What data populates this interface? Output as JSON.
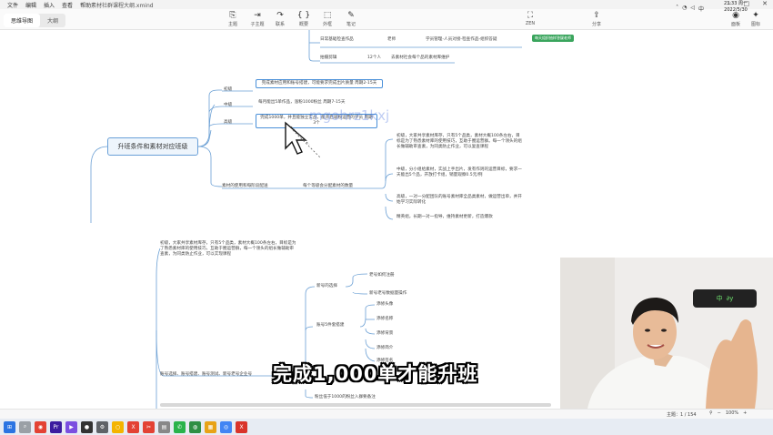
{
  "app": {
    "menus": [
      "文件",
      "编辑",
      "插入",
      "查看",
      "帮助"
    ],
    "window_title": "素材社群课程大纲.xmind"
  },
  "toolbar": {
    "view_tabs": [
      "思维导图",
      "大纲"
    ],
    "active_tab": "思维导图",
    "left_tools": [
      {
        "label": "主题",
        "icon": "topic-icon"
      },
      {
        "label": "子主题",
        "icon": "subtopic-icon"
      },
      {
        "label": "联系",
        "icon": "relationship-icon"
      },
      {
        "label": "概要",
        "icon": "summary-icon"
      },
      {
        "label": "外框",
        "icon": "boundary-icon"
      },
      {
        "label": "笔记",
        "icon": "note-icon"
      }
    ],
    "zen_label": "ZEN",
    "share_label": "分享",
    "right_tools": [
      {
        "label": "面板",
        "icon": "format-icon"
      },
      {
        "label": "图标",
        "icon": "icons-icon"
      }
    ]
  },
  "mindmap": {
    "root": "升班条件和素材对应班级",
    "top_rows": [
      {
        "left": "日常基础检查作品",
        "mid": "老师",
        "right": "学员管理-人员对接-检查作品-组织答疑"
      },
      {
        "left": "拍摄剪辑",
        "mid": "12个人",
        "right": "去素材社会每个品的素材库维护"
      }
    ],
    "badge": "每天组织抽样答疑老师",
    "levels": [
      {
        "label": "初级",
        "box": "完成素材应用和账号搭建，可能要求完成出片质量 周期2-15天"
      },
      {
        "label": "中级",
        "box": "每月能出5单作品，涨粉1000粉丝 周期7-15天"
      },
      {
        "label": "高级",
        "box": "完成1000单，并且能独立实战，能开启吸粉运营的学员 周期3个"
      }
    ],
    "material_branch": "素材的使用和每阶段配送",
    "material_sub": "每个等级会分配素材的数量",
    "material_items": [
      "初级，大家共享素材库存，只有5个品类，素材大概100条左右，目标是为了熟悉素材库的使用技巧，互助于圈运营群。每一个领头的组长做辅助审查素，为同类防止作业，可以复查课程",
      "中级，分小组给素材，实战上手出片，发有作则的运营目标，要求一天能出5个品，开放打卡组，销量观察0.5元/例",
      "高级，一对一分配团队的账号素材库全品类素材，做运营出单，并开始学习实际转化",
      "精英组，长期一对一指导，维持素材更新，打造爆款"
    ],
    "lower_intro": "初级，大家共享素材库存，只有5个品类，素材大概100条左右，目标是为了熟悉素材库的使用技巧，互助于圈运营群，每一个领头的组长做辅助审查素，为同类防止作业，可以实现课程",
    "account": {
      "branch": "账号选择、账号搭建、账号测试、新号老号企业号",
      "choose": "新号的选择",
      "choose_items": [
        "老号如何注册",
        "新号老号数据量操作"
      ],
      "build": "账号5件套搭建",
      "build_items": [
        "添修头像",
        "添修名称",
        "添修背景",
        "添修简介",
        "添修签名"
      ],
      "bottom": "粉丝低于1000的粉丝入群要备注"
    },
    "watermark": "mgohrz1kxj"
  },
  "video_overlay": {
    "subtitle": "完成1,000单才能升班",
    "pad_keys": [
      "中",
      "∂y"
    ]
  },
  "status": {
    "topics": "主题：1 / 154",
    "zoom": "100%"
  },
  "taskbar": {
    "icons": [
      "windows-start-icon",
      "search-icon",
      "chrome-icon",
      "premiere-icon",
      "media-player-icon",
      "obs-icon",
      "gear-icon",
      "circle-app-icon",
      "xmind-icon",
      "tools-icon",
      "finder-icon",
      "wechat-icon",
      "chat-icon",
      "explorer-icon",
      "browser-icon",
      "xmind-active-icon"
    ],
    "clock_time": "23:33 周一",
    "clock_date": "2022/5/30",
    "colors": [
      "#2b74e2",
      "#9aa0a6",
      "#e34234",
      "#3b1ca0",
      "#7b4fe0",
      "#333333",
      "#5f6368",
      "#f4b400",
      "#e34234",
      "#e34234",
      "#888888",
      "#29b34b",
      "#2f8f44",
      "#e8a317",
      "#4285f4",
      "#d9342b"
    ]
  }
}
